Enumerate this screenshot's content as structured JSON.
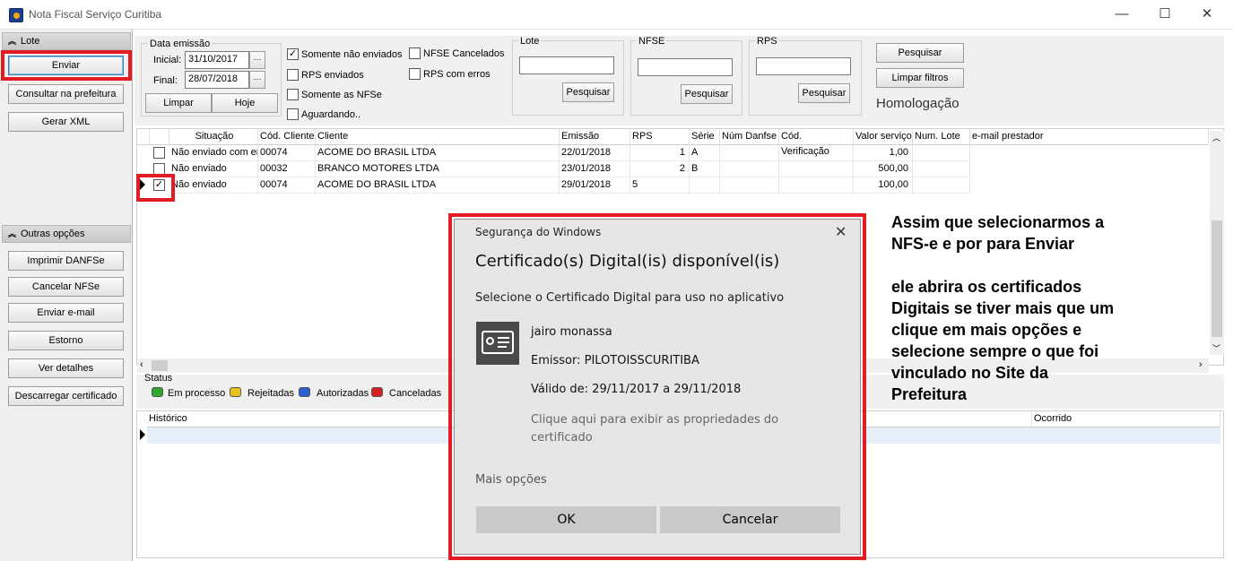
{
  "window": {
    "title": "Nota Fiscal Serviço Curitiba",
    "minimize": "—",
    "maximize": "☐",
    "close": "✕"
  },
  "sidebar": {
    "lote_title": "Lote",
    "lote_buttons": [
      "Enviar",
      "Consultar na prefeitura",
      "Gerar XML"
    ],
    "outras_title": "Outras opções",
    "outras_buttons": [
      "Imprimir DANFSe",
      "Cancelar NFSe",
      "Enviar e-mail",
      "Estorno",
      "Ver detalhes",
      "Descarregar certificado"
    ]
  },
  "filters": {
    "data_emissao": {
      "title": "Data emissão",
      "inicial_label": "Inicial:",
      "inicial_value": "31/10/2017",
      "final_label": "Final:",
      "final_value": "28/07/2018",
      "limpar": "Limpar",
      "hoje": "Hoje",
      "dots": "···"
    },
    "checks": {
      "somente_nao_enviados": {
        "label": "Somente não enviados",
        "checked": true
      },
      "rps_enviados": {
        "label": "RPS enviados",
        "checked": false
      },
      "somente_nfse": {
        "label": "Somente as NFSe",
        "checked": false
      },
      "aguardando": {
        "label": "Aguardando..",
        "checked": false
      },
      "nfse_cancelados": {
        "label": "NFSE Cancelados",
        "checked": false
      },
      "rps_com_erros": {
        "label": "RPS com erros",
        "checked": false
      }
    },
    "lote": {
      "title": "Lote",
      "value": "",
      "button": "Pesquisar"
    },
    "nfse": {
      "title": "NFSE",
      "value": "",
      "button": "Pesquisar"
    },
    "rps": {
      "title": "RPS",
      "value": "",
      "button": "Pesquisar"
    },
    "pesquisar": "Pesquisar",
    "limpar_filtros": "Limpar filtros",
    "ambiente": "Homologação"
  },
  "grid": {
    "columns": [
      "Situação",
      "Cód. Cliente",
      "Cliente",
      "Emissão",
      "RPS",
      "Série",
      "Núm Danfse",
      "Cód. Verificação",
      "Valor serviço",
      "Num. Lote",
      "e-mail prestador"
    ],
    "rows": [
      {
        "checked": false,
        "situacao": "Não enviado com er",
        "cod_cliente": "00074",
        "cliente": "ACOME DO BRASIL LTDA",
        "emissao": "22/01/2018",
        "rps": "1",
        "serie": "A",
        "valor": "1,00",
        "selected": false
      },
      {
        "checked": false,
        "situacao": "Não enviado",
        "cod_cliente": "00032",
        "cliente": "BRANCO MOTORES LTDA",
        "emissao": "23/01/2018",
        "rps": "2",
        "serie": "B",
        "valor": "500,00",
        "selected": false
      },
      {
        "checked": true,
        "situacao": "Não enviado",
        "cod_cliente": "00074",
        "cliente": "ACOME DO BRASIL LTDA",
        "emissao": "29/01/2018",
        "rps": "5",
        "serie": "",
        "valor": "100,00",
        "selected": true
      }
    ]
  },
  "status": {
    "title": "Status",
    "legend": [
      {
        "label": "Em processo",
        "color": "#2fa82f"
      },
      {
        "label": "Rejeitadas",
        "color": "#e8c21c"
      },
      {
        "label": "Autorizadas",
        "color": "#2e5fcf"
      },
      {
        "label": "Canceladas",
        "color": "#d42020"
      }
    ]
  },
  "historico": {
    "col_historico": "Histórico",
    "col_ocorrido": "Ocorrido"
  },
  "dialog": {
    "header": "Segurança do Windows",
    "title": "Certificado(s) Digital(is) disponível(is)",
    "subtitle": "Selecione o Certificado Digital para uso no aplicativo",
    "cert_name": "jairo monassa",
    "emissor": "Emissor: PILOTOISSCURITIBA",
    "validade": "Válido de: 29/11/2017 a 29/11/2018",
    "props_link": "Clique aqui para exibir as propriedades do certificado",
    "mais_opcoes": "Mais opções",
    "ok": "OK",
    "cancelar": "Cancelar"
  },
  "annotation": {
    "lines": [
      "Assim que selecionarmos a",
      "NFS-e e por para Enviar",
      "",
      "ele abrira os certificados",
      "Digitais se tiver mais que um",
      "clique em mais opções e",
      "selecione sempre o que foi",
      "vinculado no Site da",
      "Prefeitura"
    ]
  },
  "colors": {
    "highlight_red": "#e31b23",
    "selected_row": "#e6f0fb"
  }
}
